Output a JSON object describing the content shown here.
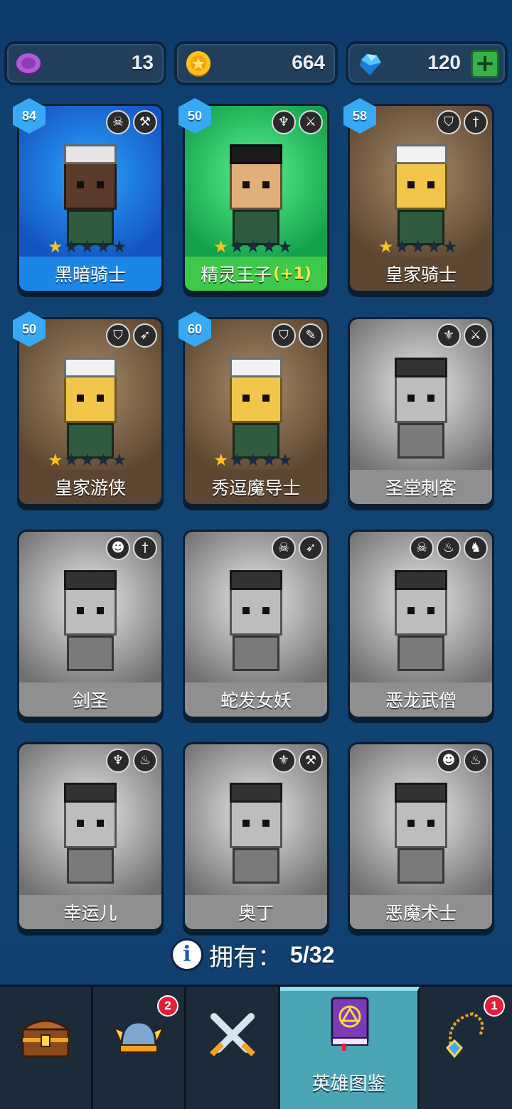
{
  "currencies": [
    {
      "icon": "purple-token-icon",
      "value": "13"
    },
    {
      "icon": "gold-coin-icon",
      "value": "664"
    },
    {
      "icon": "diamond-gem-icon",
      "value": "120"
    }
  ],
  "colors": {
    "background": "#0f3f6f",
    "blue_card": "#1c86e6",
    "green_card": "#3ec94b",
    "brown_card": "#5d4632",
    "locked_card": "#8f8f8f",
    "star_on": "#ffc21d",
    "nav_active": "#4aa6b5"
  },
  "heroes": [
    {
      "name": "黑暗骑士",
      "bonus": "",
      "level": "84",
      "owned": true,
      "rarity": "blue",
      "stars": 1,
      "max_stars": 5,
      "class_icons": [
        "skull-icon",
        "hammer-icon"
      ]
    },
    {
      "name": "精灵王子",
      "bonus": "(+1)",
      "level": "50",
      "owned": true,
      "rarity": "green",
      "stars": 1,
      "max_stars": 5,
      "class_icons": [
        "elf-icon",
        "dagger-icon"
      ]
    },
    {
      "name": "皇家骑士",
      "bonus": "",
      "level": "58",
      "owned": true,
      "rarity": "brown",
      "stars": 1,
      "max_stars": 5,
      "class_icons": [
        "helmet-icon",
        "sword-icon"
      ]
    },
    {
      "name": "皇家游侠",
      "bonus": "",
      "level": "50",
      "owned": true,
      "rarity": "brown",
      "stars": 1,
      "max_stars": 5,
      "class_icons": [
        "helmet-icon",
        "bow-icon"
      ]
    },
    {
      "name": "秀逗魔导士",
      "bonus": "",
      "level": "60",
      "owned": true,
      "rarity": "brown",
      "stars": 1,
      "max_stars": 5,
      "class_icons": [
        "helmet-icon",
        "wand-icon"
      ]
    },
    {
      "name": "圣堂刺客",
      "bonus": "",
      "level": "",
      "owned": false,
      "rarity": "gray",
      "stars": 0,
      "max_stars": 0,
      "class_icons": [
        "wings-icon",
        "dagger-icon"
      ]
    },
    {
      "name": "剑圣",
      "bonus": "",
      "level": "",
      "owned": false,
      "rarity": "gray",
      "stars": 0,
      "max_stars": 0,
      "class_icons": [
        "orc-icon",
        "sword-icon"
      ]
    },
    {
      "name": "蛇发女妖",
      "bonus": "",
      "level": "",
      "owned": false,
      "rarity": "gray",
      "stars": 0,
      "max_stars": 0,
      "class_icons": [
        "skull-icon",
        "bow-icon"
      ]
    },
    {
      "name": "恶龙武僧",
      "bonus": "",
      "level": "",
      "owned": false,
      "rarity": "gray",
      "stars": 0,
      "max_stars": 0,
      "class_icons": [
        "skull-icon",
        "claw-icon",
        "dragon-icon"
      ]
    },
    {
      "name": "幸运儿",
      "bonus": "",
      "level": "",
      "owned": false,
      "rarity": "gray",
      "stars": 0,
      "max_stars": 0,
      "class_icons": [
        "elf-icon",
        "claw-icon"
      ]
    },
    {
      "name": "奥丁",
      "bonus": "",
      "level": "",
      "owned": false,
      "rarity": "gray",
      "stars": 0,
      "max_stars": 0,
      "class_icons": [
        "wings-icon",
        "hammer-icon"
      ]
    },
    {
      "name": "恶魔术士",
      "bonus": "",
      "level": "",
      "owned": false,
      "rarity": "gray",
      "stars": 0,
      "max_stars": 0,
      "class_icons": [
        "orc-icon",
        "claw-icon"
      ]
    }
  ],
  "owned": {
    "label": "拥有：",
    "value": "5/32"
  },
  "nav": [
    {
      "icon": "treasure-chest-icon",
      "label": "",
      "badge": ""
    },
    {
      "icon": "viking-helmet-icon",
      "label": "",
      "badge": "2"
    },
    {
      "icon": "crossed-swords-icon",
      "label": "",
      "badge": ""
    },
    {
      "icon": "hero-book-icon",
      "label": "英雄图鉴",
      "badge": "",
      "active": true
    },
    {
      "icon": "amulet-icon",
      "label": "",
      "badge": "1"
    }
  ]
}
